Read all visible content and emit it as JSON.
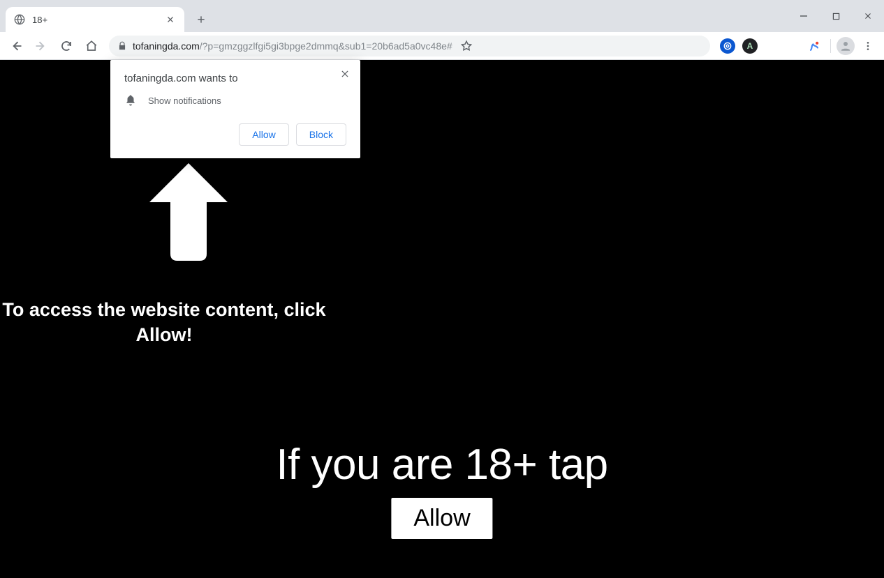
{
  "tab": {
    "title": "18+"
  },
  "url": {
    "host": "tofaningda.com",
    "path": "/?p=gmzggzlfgi5gi3bpge2dmmq&sub1=20b6ad5a0vc48e#"
  },
  "permission": {
    "title": "tofaningda.com wants to",
    "request": "Show notifications",
    "allow_label": "Allow",
    "block_label": "Block"
  },
  "page": {
    "instruction": "To access the website content, click Allow!",
    "headline": "If you are 18+ tap",
    "allow_button": "Allow"
  }
}
